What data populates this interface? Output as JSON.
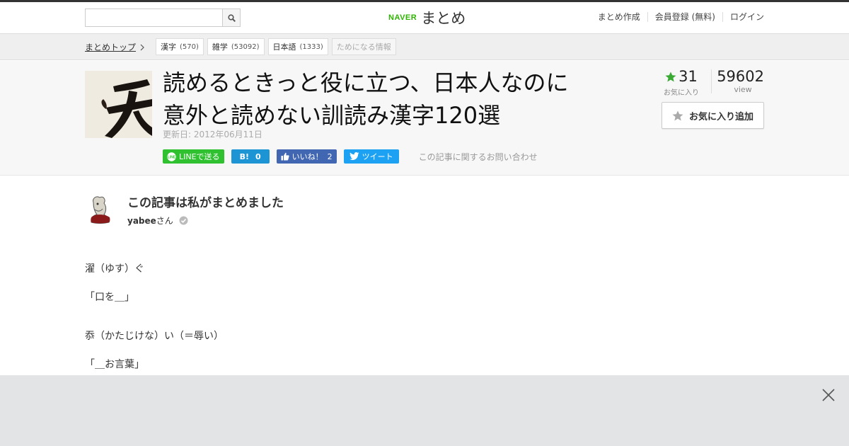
{
  "header": {
    "search_placeholder": "",
    "logo_brand": "NAVER",
    "logo_text": "まとめ",
    "nav": [
      "まとめ作成",
      "会員登録 (無料)",
      "ログイン"
    ]
  },
  "categories": {
    "breadcrumb": "まとめトップ",
    "tags": [
      {
        "label": "漢字",
        "count": "(570)"
      },
      {
        "label": "雑学",
        "count": "(53092)"
      },
      {
        "label": "日本語",
        "count": "(1333)"
      },
      {
        "label": "ためになる情報",
        "count": ""
      }
    ]
  },
  "article": {
    "title_line1": "読めるときっと役に立つ、日本人なのに",
    "title_line2": "意外と読めない訓読み漢字120選",
    "updated": "更新日: 2012年06月11日",
    "thumbnail_glyph": "天",
    "favorites_count": "31",
    "favorites_label": "お気に入り",
    "views_count": "59602",
    "views_label": "view",
    "add_favorite_label": "お気に入り追加",
    "share": {
      "line_label": "LINEで送る",
      "hatena_label": "B!",
      "hatena_count": "0",
      "like_label": "いいね！",
      "like_count": "2",
      "tweet_label": "ツイート"
    },
    "inquiry_link": "この記事に関するお問い合わせ"
  },
  "author": {
    "heading": "この記事は私がまとめました",
    "name": "yabee",
    "suffix": "さん"
  },
  "content": [
    "濯（ゆす）ぐ",
    "「口を＿」",
    "忝（かたじけな）い（＝辱い）",
    "「＿お言葉」"
  ],
  "colors": {
    "brand_green": "#2db400",
    "line_green": "#2fc12f",
    "hatena_blue": "#1d95d4",
    "facebook_blue": "#4267b2",
    "twitter_blue": "#1da1f2",
    "star_green": "#3aaa35"
  },
  "icons": [
    "search-icon",
    "chevron-right-icon",
    "star-icon",
    "star-outline-icon",
    "line-icon",
    "thumbs-up-icon",
    "twitter-bird-icon",
    "verified-check-icon",
    "close-icon"
  ]
}
